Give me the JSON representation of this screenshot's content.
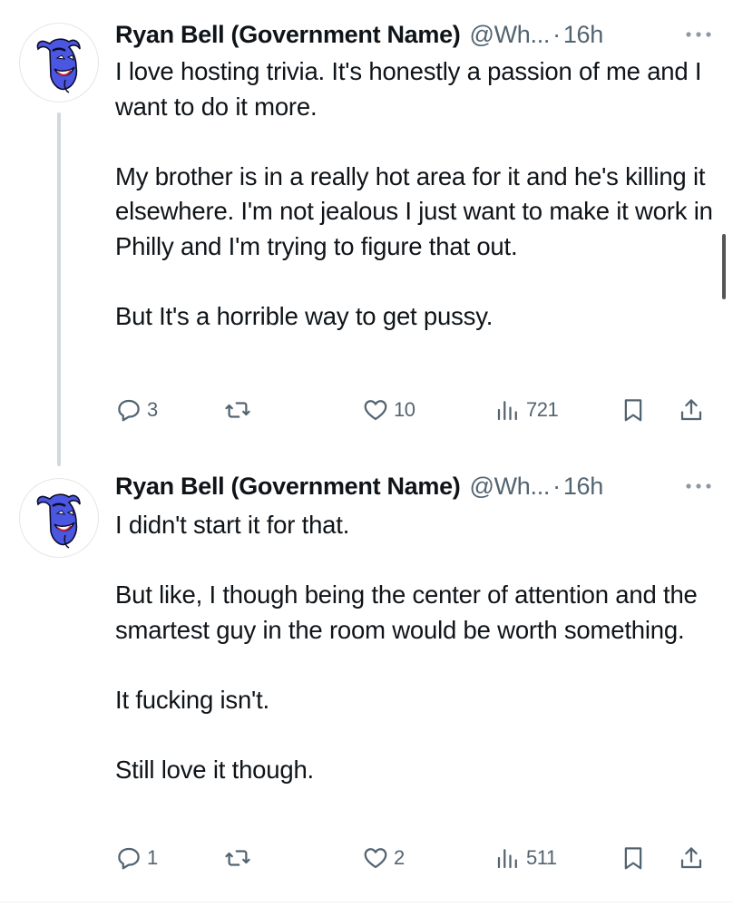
{
  "tweets": [
    {
      "display_name": "Ryan Bell (Government Name)",
      "handle": "@Wh...",
      "separator": "·",
      "time": "16h",
      "avatar_icon": "blue-genie-avatar-icon",
      "paragraphs": [
        "I love hosting trivia. It's honestly a passion of me and I want to do it more.",
        "My brother is in a really hot area for it and he's killing it elsewhere. I'm not jealous I just want to make it work in Philly and I'm trying to figure that out.",
        "But It's a horrible way to get pussy."
      ],
      "actions": {
        "replies": "3",
        "reposts": "",
        "likes": "10",
        "views": "721"
      }
    },
    {
      "display_name": "Ryan Bell (Government Name)",
      "handle": "@Wh...",
      "separator": "·",
      "time": "16h",
      "avatar_icon": "blue-genie-avatar-icon",
      "paragraphs": [
        "I didn't start it for that.",
        "But like, I though being the center of attention and the smartest guy in the room would be worth something.",
        "It fucking isn't.",
        "Still love it though."
      ],
      "actions": {
        "replies": "1",
        "reposts": "",
        "likes": "2",
        "views": "511"
      }
    }
  ],
  "icons": {
    "more": "more-dots-icon",
    "reply": "reply-bubble-icon",
    "repost": "repost-arrows-icon",
    "like": "heart-icon",
    "views": "views-bars-icon",
    "bookmark": "bookmark-icon",
    "share": "share-upload-icon"
  },
  "colors": {
    "text": "#0f1419",
    "secondary": "#536471",
    "thread_line": "#cfd9de",
    "avatar_face": "#4b57e0"
  }
}
